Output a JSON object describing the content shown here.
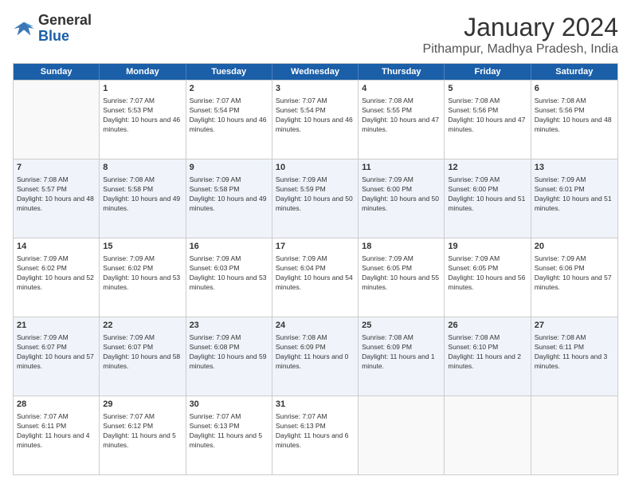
{
  "header": {
    "logo_general": "General",
    "logo_blue": "Blue",
    "month_title": "January 2024",
    "location": "Pithampur, Madhya Pradesh, India"
  },
  "calendar": {
    "days_of_week": [
      "Sunday",
      "Monday",
      "Tuesday",
      "Wednesday",
      "Thursday",
      "Friday",
      "Saturday"
    ],
    "rows": [
      {
        "alt": false,
        "cells": [
          {
            "day": "",
            "empty": true
          },
          {
            "day": "1",
            "sunrise": "7:07 AM",
            "sunset": "5:53 PM",
            "daylight": "10 hours and 46 minutes."
          },
          {
            "day": "2",
            "sunrise": "7:07 AM",
            "sunset": "5:54 PM",
            "daylight": "10 hours and 46 minutes."
          },
          {
            "day": "3",
            "sunrise": "7:07 AM",
            "sunset": "5:54 PM",
            "daylight": "10 hours and 46 minutes."
          },
          {
            "day": "4",
            "sunrise": "7:08 AM",
            "sunset": "5:55 PM",
            "daylight": "10 hours and 47 minutes."
          },
          {
            "day": "5",
            "sunrise": "7:08 AM",
            "sunset": "5:56 PM",
            "daylight": "10 hours and 47 minutes."
          },
          {
            "day": "6",
            "sunrise": "7:08 AM",
            "sunset": "5:56 PM",
            "daylight": "10 hours and 48 minutes."
          }
        ]
      },
      {
        "alt": true,
        "cells": [
          {
            "day": "7",
            "sunrise": "7:08 AM",
            "sunset": "5:57 PM",
            "daylight": "10 hours and 48 minutes."
          },
          {
            "day": "8",
            "sunrise": "7:08 AM",
            "sunset": "5:58 PM",
            "daylight": "10 hours and 49 minutes."
          },
          {
            "day": "9",
            "sunrise": "7:09 AM",
            "sunset": "5:58 PM",
            "daylight": "10 hours and 49 minutes."
          },
          {
            "day": "10",
            "sunrise": "7:09 AM",
            "sunset": "5:59 PM",
            "daylight": "10 hours and 50 minutes."
          },
          {
            "day": "11",
            "sunrise": "7:09 AM",
            "sunset": "6:00 PM",
            "daylight": "10 hours and 50 minutes."
          },
          {
            "day": "12",
            "sunrise": "7:09 AM",
            "sunset": "6:00 PM",
            "daylight": "10 hours and 51 minutes."
          },
          {
            "day": "13",
            "sunrise": "7:09 AM",
            "sunset": "6:01 PM",
            "daylight": "10 hours and 51 minutes."
          }
        ]
      },
      {
        "alt": false,
        "cells": [
          {
            "day": "14",
            "sunrise": "7:09 AM",
            "sunset": "6:02 PM",
            "daylight": "10 hours and 52 minutes."
          },
          {
            "day": "15",
            "sunrise": "7:09 AM",
            "sunset": "6:02 PM",
            "daylight": "10 hours and 53 minutes."
          },
          {
            "day": "16",
            "sunrise": "7:09 AM",
            "sunset": "6:03 PM",
            "daylight": "10 hours and 53 minutes."
          },
          {
            "day": "17",
            "sunrise": "7:09 AM",
            "sunset": "6:04 PM",
            "daylight": "10 hours and 54 minutes."
          },
          {
            "day": "18",
            "sunrise": "7:09 AM",
            "sunset": "6:05 PM",
            "daylight": "10 hours and 55 minutes."
          },
          {
            "day": "19",
            "sunrise": "7:09 AM",
            "sunset": "6:05 PM",
            "daylight": "10 hours and 56 minutes."
          },
          {
            "day": "20",
            "sunrise": "7:09 AM",
            "sunset": "6:06 PM",
            "daylight": "10 hours and 57 minutes."
          }
        ]
      },
      {
        "alt": true,
        "cells": [
          {
            "day": "21",
            "sunrise": "7:09 AM",
            "sunset": "6:07 PM",
            "daylight": "10 hours and 57 minutes."
          },
          {
            "day": "22",
            "sunrise": "7:09 AM",
            "sunset": "6:07 PM",
            "daylight": "10 hours and 58 minutes."
          },
          {
            "day": "23",
            "sunrise": "7:09 AM",
            "sunset": "6:08 PM",
            "daylight": "10 hours and 59 minutes."
          },
          {
            "day": "24",
            "sunrise": "7:08 AM",
            "sunset": "6:09 PM",
            "daylight": "11 hours and 0 minutes."
          },
          {
            "day": "25",
            "sunrise": "7:08 AM",
            "sunset": "6:09 PM",
            "daylight": "11 hours and 1 minute."
          },
          {
            "day": "26",
            "sunrise": "7:08 AM",
            "sunset": "6:10 PM",
            "daylight": "11 hours and 2 minutes."
          },
          {
            "day": "27",
            "sunrise": "7:08 AM",
            "sunset": "6:11 PM",
            "daylight": "11 hours and 3 minutes."
          }
        ]
      },
      {
        "alt": false,
        "cells": [
          {
            "day": "28",
            "sunrise": "7:07 AM",
            "sunset": "6:11 PM",
            "daylight": "11 hours and 4 minutes."
          },
          {
            "day": "29",
            "sunrise": "7:07 AM",
            "sunset": "6:12 PM",
            "daylight": "11 hours and 5 minutes."
          },
          {
            "day": "30",
            "sunrise": "7:07 AM",
            "sunset": "6:13 PM",
            "daylight": "11 hours and 5 minutes."
          },
          {
            "day": "31",
            "sunrise": "7:07 AM",
            "sunset": "6:13 PM",
            "daylight": "11 hours and 6 minutes."
          },
          {
            "day": "",
            "empty": true
          },
          {
            "day": "",
            "empty": true
          },
          {
            "day": "",
            "empty": true
          }
        ]
      }
    ]
  }
}
